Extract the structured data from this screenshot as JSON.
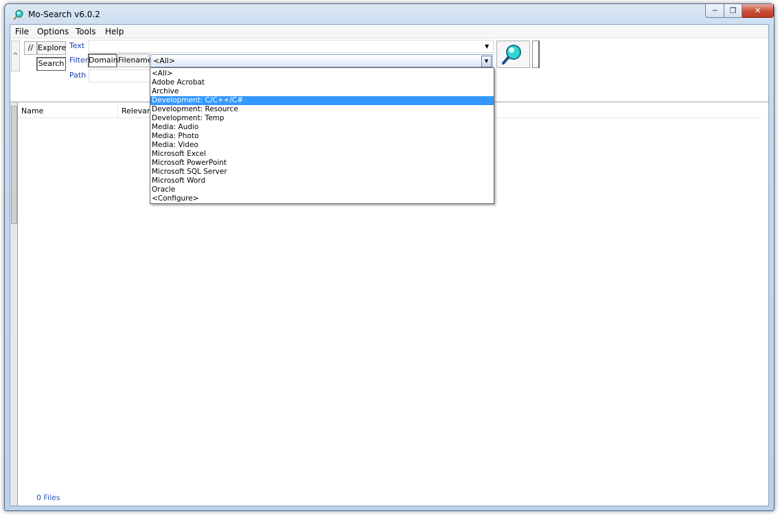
{
  "window": {
    "title": "Mo-Search v6.0.2"
  },
  "menu": [
    "File",
    "Options",
    "Tools",
    "Help"
  ],
  "toolbar": {
    "collapse_glyph": "^",
    "slash_label": "//",
    "explore_label": "Explore",
    "search_label": "Search",
    "text_label": "Text",
    "text_value": "",
    "filter_label": "Filter",
    "domain_label": "Domain",
    "filename_label": "Filename",
    "filter_value": "<All>",
    "path_label": "Path",
    "path_value": "",
    "search_icon": "magnifier-icon"
  },
  "columns": [
    "Name",
    "Relevance"
  ],
  "dropdown": {
    "items": [
      "<All>",
      "Adobe Acrobat",
      "Archive",
      "Development: C/C++/C#",
      "Development: Resource",
      "Development: Temp",
      "Media: Audio",
      "Media: Photo",
      "Media: Video",
      "Microsoft Excel",
      "Microsoft PowerPoint",
      "Microsoft SQL Server",
      "Microsoft Word",
      "Oracle",
      "<Configure>"
    ],
    "selected_index": 3,
    "highlight_color": "#3399ff"
  },
  "status": {
    "files": "0 Files"
  },
  "colors": {
    "label_blue": "#1a3fb5",
    "status_blue": "#2a5ab8"
  }
}
